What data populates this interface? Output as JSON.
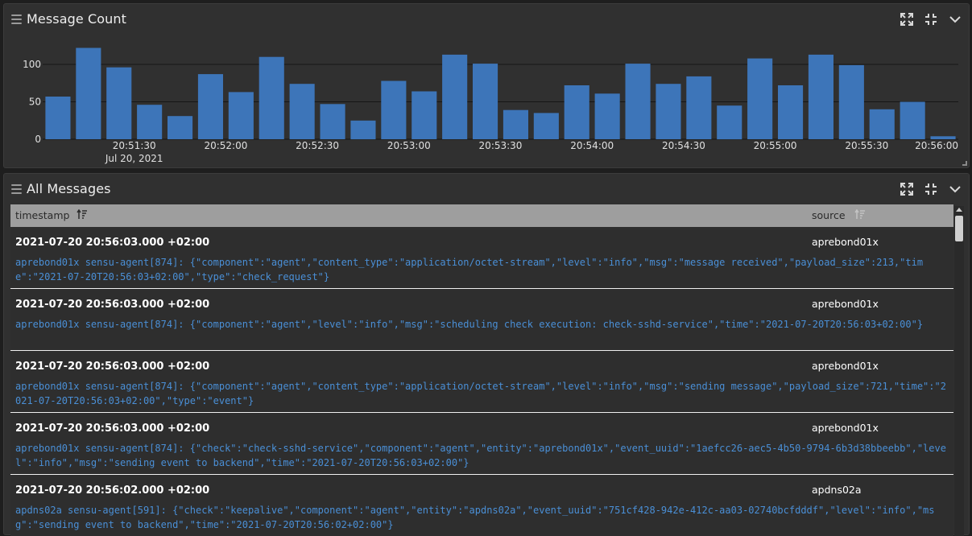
{
  "chart_panel": {
    "title": "Message Count",
    "icons": [
      "expand-icon",
      "collapse-icon",
      "chevron-down-icon"
    ]
  },
  "messages_panel": {
    "title": "All Messages",
    "icons": [
      "expand-icon",
      "collapse-icon",
      "chevron-down-icon"
    ],
    "columns": [
      {
        "label": "timestamp",
        "sort_icon": "sort-desc-icon"
      },
      {
        "label": "source",
        "sort_icon": "sort-icon"
      }
    ],
    "rows": [
      {
        "timestamp": "2021-07-20 20:56:03.000 +02:00",
        "source": "aprebond01x",
        "message": "aprebond01x sensu-agent[874]: {\"component\":\"agent\",\"content_type\":\"application/octet-stream\",\"level\":\"info\",\"msg\":\"message received\",\"payload_size\":213,\"time\":\"2021-07-20T20:56:03+02:00\",\"type\":\"check_request\"}"
      },
      {
        "timestamp": "2021-07-20 20:56:03.000 +02:00",
        "source": "aprebond01x",
        "message": "aprebond01x sensu-agent[874]: {\"component\":\"agent\",\"level\":\"info\",\"msg\":\"scheduling check execution: check-sshd-service\",\"time\":\"2021-07-20T20:56:03+02:00\"}"
      },
      {
        "timestamp": "2021-07-20 20:56:03.000 +02:00",
        "source": "aprebond01x",
        "message": "aprebond01x sensu-agent[874]: {\"component\":\"agent\",\"content_type\":\"application/octet-stream\",\"level\":\"info\",\"msg\":\"sending message\",\"payload_size\":721,\"time\":\"2021-07-20T20:56:03+02:00\",\"type\":\"event\"}"
      },
      {
        "timestamp": "2021-07-20 20:56:03.000 +02:00",
        "source": "aprebond01x",
        "message": "aprebond01x sensu-agent[874]: {\"check\":\"check-sshd-service\",\"component\":\"agent\",\"entity\":\"aprebond01x\",\"event_uuid\":\"1aefcc26-aec5-4b50-9794-6b3d38bbeebb\",\"level\":\"info\",\"msg\":\"sending event to backend\",\"time\":\"2021-07-20T20:56:03+02:00\"}"
      },
      {
        "timestamp": "2021-07-20 20:56:02.000 +02:00",
        "source": "apdns02a",
        "message": "apdns02a sensu-agent[591]: {\"check\":\"keepalive\",\"component\":\"agent\",\"entity\":\"apdns02a\",\"event_uuid\":\"751cf428-942e-412c-aa03-02740bcfdddf\",\"level\":\"info\",\"msg\":\"sending event to backend\",\"time\":\"2021-07-20T20:56:02+02:00\"}"
      }
    ]
  },
  "colors": {
    "bar": "#3d75b9",
    "message_text": "#4a8fd6",
    "panel_bg": "#303030",
    "header_bg": "#9e9e9e"
  },
  "chart_data": {
    "type": "bar",
    "title": "",
    "xlabel": "",
    "ylabel": "",
    "x_start": "20:51:10",
    "x_step_seconds": 10,
    "values": [
      57,
      122,
      96,
      46,
      31,
      87,
      63,
      110,
      74,
      47,
      25,
      78,
      64,
      113,
      101,
      39,
      35,
      72,
      61,
      101,
      74,
      84,
      45,
      108,
      72,
      113,
      99,
      40,
      50,
      4
    ],
    "x_ticks": [
      "20:51:30",
      "20:52:00",
      "20:52:30",
      "20:53:00",
      "20:53:30",
      "20:54:00",
      "20:54:30",
      "20:55:00",
      "20:55:30",
      "20:56:00"
    ],
    "x_subtick": "Jul 20, 2021",
    "y_ticks": [
      "0",
      "50",
      "100"
    ],
    "ylim": [
      0,
      130
    ],
    "grid": true,
    "legend": "none"
  }
}
